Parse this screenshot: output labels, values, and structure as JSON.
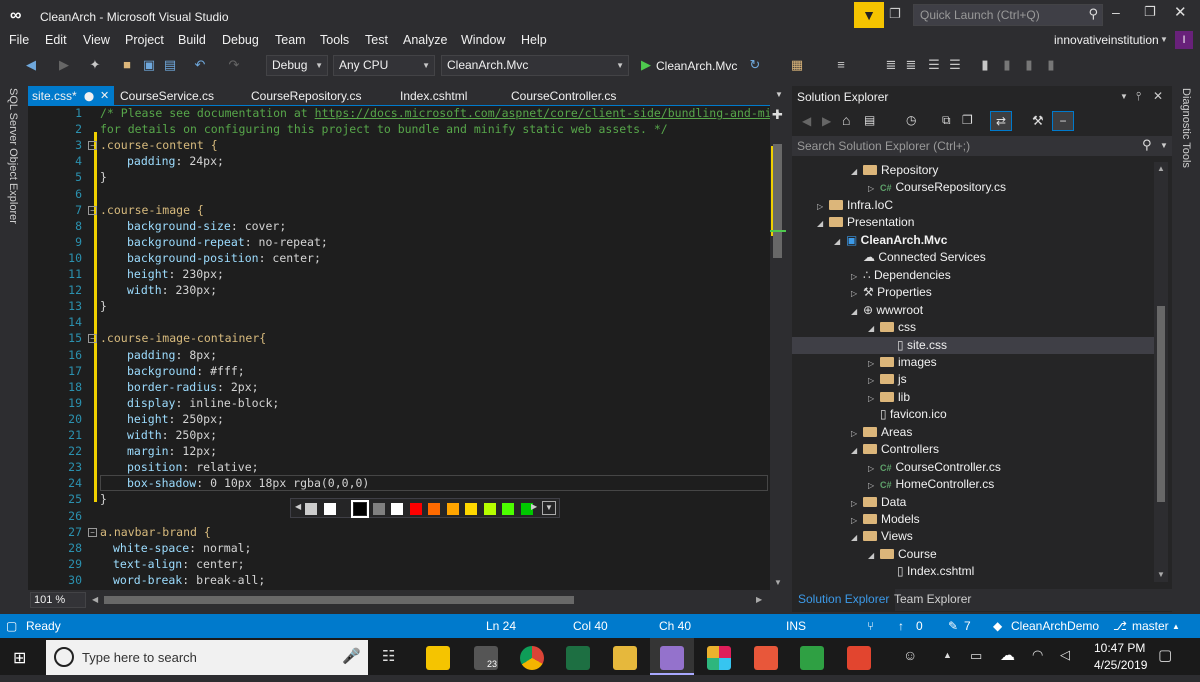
{
  "window": {
    "title": "CleanArch - Microsoft Visual Studio",
    "quick_launch": "Quick Launch (Ctrl+Q)",
    "user": "innovativeinstitution",
    "user_initial": "I"
  },
  "menu": [
    "File",
    "Edit",
    "View",
    "Project",
    "Build",
    "Debug",
    "Team",
    "Tools",
    "Test",
    "Analyze",
    "Window",
    "Help"
  ],
  "toolbar": {
    "config": "Debug",
    "platform": "Any CPU",
    "startup": "CleanArch.Mvc",
    "run_target": "CleanArch.Mvc"
  },
  "side_panels": {
    "left": "SQL Server Object Explorer",
    "right": "Diagnostic Tools"
  },
  "tabs": [
    "site.css*",
    "CourseService.cs",
    "CourseRepository.cs",
    "Index.cshtml",
    "CourseController.cs"
  ],
  "editor": {
    "lines": [
      {
        "n": "1",
        "t": "/* Please see documentation at ",
        "link": "https://docs.microsoft.com/aspnet/core/client-side/bundling-and-mini"
      },
      {
        "n": "2",
        "t": "for details on configuring this project to bundle and minify static web assets. */"
      },
      {
        "n": "3",
        "t": ".course-content {"
      },
      {
        "n": "4",
        "p": "padding",
        "v": ": 24px;"
      },
      {
        "n": "5",
        "t": "}"
      },
      {
        "n": "6",
        "t": ""
      },
      {
        "n": "7",
        "t": ".course-image {"
      },
      {
        "n": "8",
        "p": "background-size",
        "v": ": cover;"
      },
      {
        "n": "9",
        "p": "background-repeat",
        "v": ": no-repeat;"
      },
      {
        "n": "10",
        "p": "background-position",
        "v": ": center;"
      },
      {
        "n": "11",
        "p": "height",
        "v": ": 230px;"
      },
      {
        "n": "12",
        "p": "width",
        "v": ": 230px;"
      },
      {
        "n": "13",
        "t": "}"
      },
      {
        "n": "14",
        "t": ""
      },
      {
        "n": "15",
        "t": ".course-image-container{"
      },
      {
        "n": "16",
        "p": "padding",
        "v": ": 8px;"
      },
      {
        "n": "17",
        "p": "background",
        "v": ": #fff;"
      },
      {
        "n": "18",
        "p": "border-radius",
        "v": ": 2px;"
      },
      {
        "n": "19",
        "p": "display",
        "v": ": inline-block;"
      },
      {
        "n": "20",
        "p": "height",
        "v": ": 250px;"
      },
      {
        "n": "21",
        "p": "width",
        "v": ": 250px;"
      },
      {
        "n": "22",
        "p": "margin",
        "v": ": 12px;"
      },
      {
        "n": "23",
        "p": "position",
        "v": ": relative;"
      },
      {
        "n": "24",
        "p": "box-shadow",
        "v": ": 0 10px 18px rgba(0,0,0)"
      },
      {
        "n": "25",
        "t": "}"
      },
      {
        "n": "26",
        "t": ""
      },
      {
        "n": "27",
        "t": "a.navbar-brand {"
      },
      {
        "n": "28",
        "p": "white-space",
        "v": ": normal;"
      },
      {
        "n": "29",
        "p": "text-align",
        "v": ": center;"
      },
      {
        "n": "30",
        "p": "word-break",
        "v": ": break-all;"
      }
    ],
    "zoom": "101 %",
    "swatches": [
      "#cccccc",
      "#ffffff",
      "#000000",
      "#808080",
      "#ffffff",
      "#ff0000",
      "#ff6a00",
      "#ffa500",
      "#ffd800",
      "#b6ff00",
      "#4cff00",
      "#00c800"
    ]
  },
  "solution_explorer": {
    "title": "Solution Explorer",
    "search_placeholder": "Search Solution Explorer (Ctrl+;)",
    "items": [
      {
        "label": "Repository",
        "level": 3,
        "kind": "folder",
        "exp": "open"
      },
      {
        "label": "CourseRepository.cs",
        "level": 4,
        "kind": "cs",
        "exp": "closed"
      },
      {
        "label": "Infra.IoC",
        "level": 1,
        "kind": "folder",
        "exp": "closed"
      },
      {
        "label": "Presentation",
        "level": 1,
        "kind": "folder",
        "exp": "open"
      },
      {
        "label": "CleanArch.Mvc",
        "level": 2,
        "kind": "project",
        "exp": "open",
        "bold": true
      },
      {
        "label": "Connected Services",
        "level": 3,
        "kind": "svc",
        "exp": ""
      },
      {
        "label": "Dependencies",
        "level": 3,
        "kind": "dep",
        "exp": "closed"
      },
      {
        "label": "Properties",
        "level": 3,
        "kind": "prop",
        "exp": "closed"
      },
      {
        "label": "wwwroot",
        "level": 3,
        "kind": "globe",
        "exp": "open"
      },
      {
        "label": "css",
        "level": 4,
        "kind": "folder",
        "exp": "open"
      },
      {
        "label": "site.css",
        "level": 5,
        "kind": "file",
        "exp": "",
        "selected": true
      },
      {
        "label": "images",
        "level": 4,
        "kind": "folder",
        "exp": "closed"
      },
      {
        "label": "js",
        "level": 4,
        "kind": "folder",
        "exp": "closed"
      },
      {
        "label": "lib",
        "level": 4,
        "kind": "folder",
        "exp": "closed"
      },
      {
        "label": "favicon.ico",
        "level": 4,
        "kind": "file",
        "exp": ""
      },
      {
        "label": "Areas",
        "level": 3,
        "kind": "folder",
        "exp": "closed"
      },
      {
        "label": "Controllers",
        "level": 3,
        "kind": "folder",
        "exp": "open"
      },
      {
        "label": "CourseController.cs",
        "level": 4,
        "kind": "cs",
        "exp": "closed"
      },
      {
        "label": "HomeController.cs",
        "level": 4,
        "kind": "cs",
        "exp": "closed"
      },
      {
        "label": "Data",
        "level": 3,
        "kind": "folder",
        "exp": "closed"
      },
      {
        "label": "Models",
        "level": 3,
        "kind": "folder",
        "exp": "closed"
      },
      {
        "label": "Views",
        "level": 3,
        "kind": "folder",
        "exp": "open"
      },
      {
        "label": "Course",
        "level": 4,
        "kind": "folder",
        "exp": "open"
      },
      {
        "label": "Index.cshtml",
        "level": 5,
        "kind": "file",
        "exp": ""
      }
    ],
    "bottom_tabs": [
      "Solution Explorer",
      "Team Explorer"
    ]
  },
  "status": {
    "ready": "Ready",
    "ln": "Ln 24",
    "col": "Col 40",
    "ch": "Ch 40",
    "ins": "INS",
    "up": "0",
    "edits": "7",
    "repo": "CleanArchDemo",
    "branch": "master"
  },
  "taskbar": {
    "search": "Type here to search",
    "time": "10:47 PM",
    "date": "4/25/2019",
    "badge": "23"
  }
}
